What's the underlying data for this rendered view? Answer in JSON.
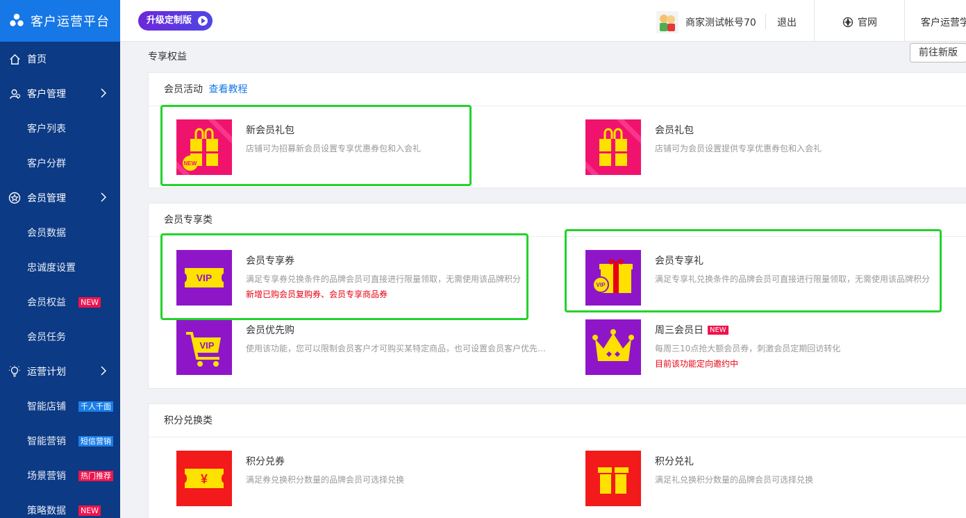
{
  "brand": {
    "title": "客户运营平台"
  },
  "sidebar": {
    "items": [
      {
        "label": "首页",
        "icon": "home-icon"
      },
      {
        "label": "客户管理",
        "icon": "user-icon"
      },
      {
        "label": "客户列表"
      },
      {
        "label": "客户分群"
      },
      {
        "label": "会员管理",
        "icon": "star-icon"
      },
      {
        "label": "会员数据"
      },
      {
        "label": "忠诚度设置"
      },
      {
        "label": "会员权益",
        "badge": "NEW"
      },
      {
        "label": "会员任务"
      },
      {
        "label": "运营计划",
        "icon": "lightbulb-icon"
      },
      {
        "label": "智能店铺",
        "badge": "千人千面"
      },
      {
        "label": "智能营销",
        "badge": "短信营销"
      },
      {
        "label": "场景营销",
        "badge": "热门推荐"
      },
      {
        "label": "策略数据",
        "badge": "NEW"
      }
    ]
  },
  "header": {
    "upgrade_label": "升级定制版",
    "account_name": "商家测试帐号70",
    "logout_label": "退出",
    "official_label": "官网",
    "truncated_label": "客户运营学"
  },
  "main": {
    "page_title": "专享权益",
    "new_version_label": "前往新版",
    "sections": [
      {
        "title": "会员活动",
        "link": "查看教程",
        "items": [
          {
            "name": "新会员礼包",
            "desc": "店铺可为招募新会员设置专享优惠券包和入会礼"
          },
          {
            "name": "会员礼包",
            "desc": "店铺可为会员设置提供专享优惠券包和入会礼"
          }
        ]
      },
      {
        "title": "会员专享类",
        "items": [
          {
            "name": "会员专享券",
            "desc": "满足专享券兑换条件的品牌会员可直接进行限量领取，无需使用该品牌积分",
            "note": "新增已购会员复购券、会员专享商品券"
          },
          {
            "name": "会员专享礼",
            "desc": "满足专享礼兑换条件的品牌会员可直接进行限量领取，无需使用该品牌积分"
          },
          {
            "name": "会员优先购",
            "desc": "使用该功能，您可以限制会员客户才可购买某特定商品，也可设置会员客户优先…"
          },
          {
            "name": "周三会员日",
            "tag": "NEW",
            "desc": "每周三10点抢大额会员券，刺激会员定期回访转化",
            "note": "目前该功能定向邀约中"
          }
        ]
      },
      {
        "title": "积分兑换类",
        "items": [
          {
            "name": "积分兑券",
            "desc": "满足券兑换积分数量的品牌会员可选择兑换"
          },
          {
            "name": "积分兑礼",
            "desc": "满足礼兑换积分数量的品牌会员可选择兑换"
          }
        ]
      }
    ]
  },
  "thumb_labels": {
    "new": "NEW",
    "vip": "VIP",
    "yen": "¥"
  },
  "colors": {
    "sidebar_bg": "#0c3a84",
    "brand_bg": "#1677e6",
    "pink": "#f0136e",
    "purple": "#8f16c8",
    "red": "#f21a1a",
    "yellow": "#ffe100",
    "highlight": "#22d32a"
  }
}
